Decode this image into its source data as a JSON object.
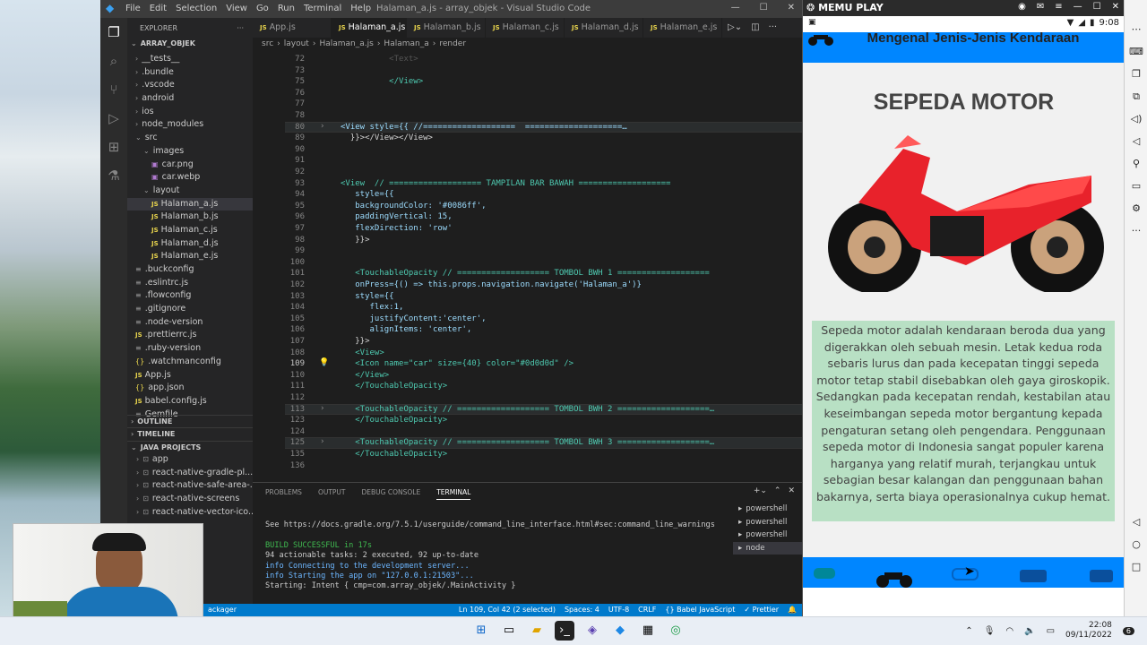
{
  "vscode": {
    "menu": [
      "File",
      "Edit",
      "Selection",
      "View",
      "Go",
      "Run",
      "Terminal",
      "Help"
    ],
    "title": "Halaman_a.js - array_objek - Visual Studio Code",
    "explorer_label": "EXPLORER",
    "project": "ARRAY_OBJEK",
    "tree": [
      {
        "label": "__tests__",
        "kind": "folder",
        "indent": 1
      },
      {
        "label": ".bundle",
        "kind": "folder",
        "indent": 1
      },
      {
        "label": ".vscode",
        "kind": "folder",
        "indent": 1
      },
      {
        "label": "android",
        "kind": "folder",
        "indent": 1
      },
      {
        "label": "ios",
        "kind": "folder",
        "indent": 1
      },
      {
        "label": "node_modules",
        "kind": "folder",
        "indent": 1
      },
      {
        "label": "src",
        "kind": "open",
        "indent": 1
      },
      {
        "label": "images",
        "kind": "open",
        "indent": 2
      },
      {
        "label": "car.png",
        "kind": "img",
        "indent": 3
      },
      {
        "label": "car.webp",
        "kind": "img",
        "indent": 3
      },
      {
        "label": "layout",
        "kind": "open",
        "indent": 2
      },
      {
        "label": "Halaman_a.js",
        "kind": "js",
        "indent": 3,
        "selected": true
      },
      {
        "label": "Halaman_b.js",
        "kind": "js",
        "indent": 3
      },
      {
        "label": "Halaman_c.js",
        "kind": "js",
        "indent": 3
      },
      {
        "label": "Halaman_d.js",
        "kind": "js",
        "indent": 3
      },
      {
        "label": "Halaman_e.js",
        "kind": "js",
        "indent": 3
      },
      {
        "label": ".buckconfig",
        "kind": "file",
        "indent": 1
      },
      {
        "label": ".eslintrc.js",
        "kind": "file",
        "indent": 1
      },
      {
        "label": ".flowconfig",
        "kind": "file",
        "indent": 1
      },
      {
        "label": ".gitignore",
        "kind": "file",
        "indent": 1
      },
      {
        "label": ".node-version",
        "kind": "file",
        "indent": 1
      },
      {
        "label": ".prettierrc.js",
        "kind": "js",
        "indent": 1
      },
      {
        "label": ".ruby-version",
        "kind": "file",
        "indent": 1
      },
      {
        "label": ".watchmanconfig",
        "kind": "cfg",
        "indent": 1
      },
      {
        "label": "App.js",
        "kind": "js",
        "indent": 1
      },
      {
        "label": "app.json",
        "kind": "cfg",
        "indent": 1
      },
      {
        "label": "babel.config.js",
        "kind": "js",
        "indent": 1
      },
      {
        "label": "Gemfile",
        "kind": "file",
        "indent": 1
      }
    ],
    "outline": "OUTLINE",
    "timeline": "TIMELINE",
    "java_projects": "JAVA PROJECTS",
    "java_items": [
      "app",
      "react-native-gradle-pl...",
      "react-native-safe-area-...",
      "react-native-screens",
      "react-native-vector-ico..."
    ],
    "tabs": [
      {
        "label": "App.js",
        "active": false,
        "marker": ""
      },
      {
        "label": "Halaman_a.js",
        "active": true,
        "marker": "✕"
      },
      {
        "label": "Halaman_b.js",
        "active": false,
        "marker": ""
      },
      {
        "label": "Halaman_c.js",
        "active": false,
        "marker": "●"
      },
      {
        "label": "Halaman_d.js",
        "active": false,
        "marker": "●"
      },
      {
        "label": "Halaman_e.js",
        "active": false,
        "marker": "●"
      }
    ],
    "breadcrumb": [
      "src",
      "layout",
      "Halaman_a.js",
      "Halaman_a",
      "render"
    ],
    "code": [
      {
        "n": "72",
        "t": "          <Text>",
        "dim": true
      },
      {
        "n": "73",
        "t": ""
      },
      {
        "n": "75",
        "t": "          </View>"
      },
      {
        "n": "76",
        "t": ""
      },
      {
        "n": "77",
        "t": ""
      },
      {
        "n": "78",
        "t": ""
      },
      {
        "n": "80",
        "t": "<View style={{ //===================  ====================…",
        "fold": true,
        "hl": true
      },
      {
        "n": "89",
        "t": "  }}></View></View>"
      },
      {
        "n": "90",
        "t": ""
      },
      {
        "n": "91",
        "t": ""
      },
      {
        "n": "92",
        "t": ""
      },
      {
        "n": "93",
        "t": "<View  // =================== TAMPILAN BAR BAWAH ==================="
      },
      {
        "n": "94",
        "t": "   style={{"
      },
      {
        "n": "95",
        "t": "   backgroundColor: '#0086ff',"
      },
      {
        "n": "96",
        "t": "   paddingVertical: 15,"
      },
      {
        "n": "97",
        "t": "   flexDirection: 'row'"
      },
      {
        "n": "98",
        "t": "   }}>"
      },
      {
        "n": "99",
        "t": ""
      },
      {
        "n": "100",
        "t": ""
      },
      {
        "n": "101",
        "t": "   <TouchableOpacity // =================== TOMBOL BWH 1 ==================="
      },
      {
        "n": "102",
        "t": "   onPress={() => this.props.navigation.navigate('Halaman_a')}"
      },
      {
        "n": "103",
        "t": "   style={{"
      },
      {
        "n": "104",
        "t": "      flex:1,"
      },
      {
        "n": "105",
        "t": "      justifyContent:'center',"
      },
      {
        "n": "106",
        "t": "      alignItems: 'center',"
      },
      {
        "n": "107",
        "t": "   }}>"
      },
      {
        "n": "108",
        "t": "   <View>"
      },
      {
        "n": "109",
        "t": "   <Icon name=\"car\" size={40} color=\"#0d0d0d\" />",
        "cur": true
      },
      {
        "n": "110",
        "t": "   </View>"
      },
      {
        "n": "111",
        "t": "   </TouchableOpacity>"
      },
      {
        "n": "112",
        "t": ""
      },
      {
        "n": "113",
        "t": "   <TouchableOpacity // =================== TOMBOL BWH 2 ===================…",
        "fold": true,
        "hl": true
      },
      {
        "n": "123",
        "t": "   </TouchableOpacity>"
      },
      {
        "n": "124",
        "t": ""
      },
      {
        "n": "125",
        "t": "   <TouchableOpacity // =================== TOMBOL BWH 3 ===================…",
        "fold": true,
        "hl": true
      },
      {
        "n": "135",
        "t": "   </TouchableOpacity>"
      },
      {
        "n": "136",
        "t": ""
      }
    ],
    "panel_tabs": [
      "PROBLEMS",
      "OUTPUT",
      "DEBUG CONSOLE",
      "TERMINAL"
    ],
    "terminal": [
      "See https://docs.gradle.org/7.5.1/userguide/command_line_interface.html#sec:command_line_warnings",
      "",
      "BUILD SUCCESSFUL in 17s",
      "94 actionable tasks: 2 executed, 92 up-to-date",
      "info Connecting to the development server...",
      "info Starting the app on \"127.0.0.1:21503\"...",
      "Starting: Intent { cmp=com.array_objek/.MainActivity }"
    ],
    "terminal_list": [
      "powershell",
      "powershell",
      "powershell",
      "node"
    ],
    "status_left": "ackager",
    "status_right": [
      "Ln 109, Col 42 (2 selected)",
      "Spaces: 4",
      "UTF-8",
      "CRLF",
      "{} Babel JavaScript",
      "✓ Prettier"
    ]
  },
  "memu": {
    "brand": "MEMU PLAY",
    "time": "9:08",
    "app_title": "Mengenal Jenis-Jenis Kendaraan",
    "heading": "SEPEDA MOTOR",
    "description": "Sepeda motor adalah kendaraan beroda dua yang digerakkan oleh sebuah mesin. Letak kedua roda sebaris lurus dan pada kecepatan tinggi sepeda motor tetap stabil disebabkan oleh gaya giroskopik. Sedangkan pada kecepatan rendah, kestabilan atau keseimbangan sepeda motor bergantung kepada pengaturan setang oleh pengendara. Penggunaan sepeda motor di Indonesia sangat populer karena harganya yang relatif murah, terjangkau untuk sebagian besar kalangan dan penggunaan bahan bakarnya, serta biaya operasionalnya cukup hemat.",
    "accent": "#0086ff",
    "desc_bg": "#b8e0c4",
    "bike_color": "#e8222b"
  },
  "taskbar": {
    "time": "22:08",
    "date": "09/11/2022",
    "notif": "6"
  }
}
